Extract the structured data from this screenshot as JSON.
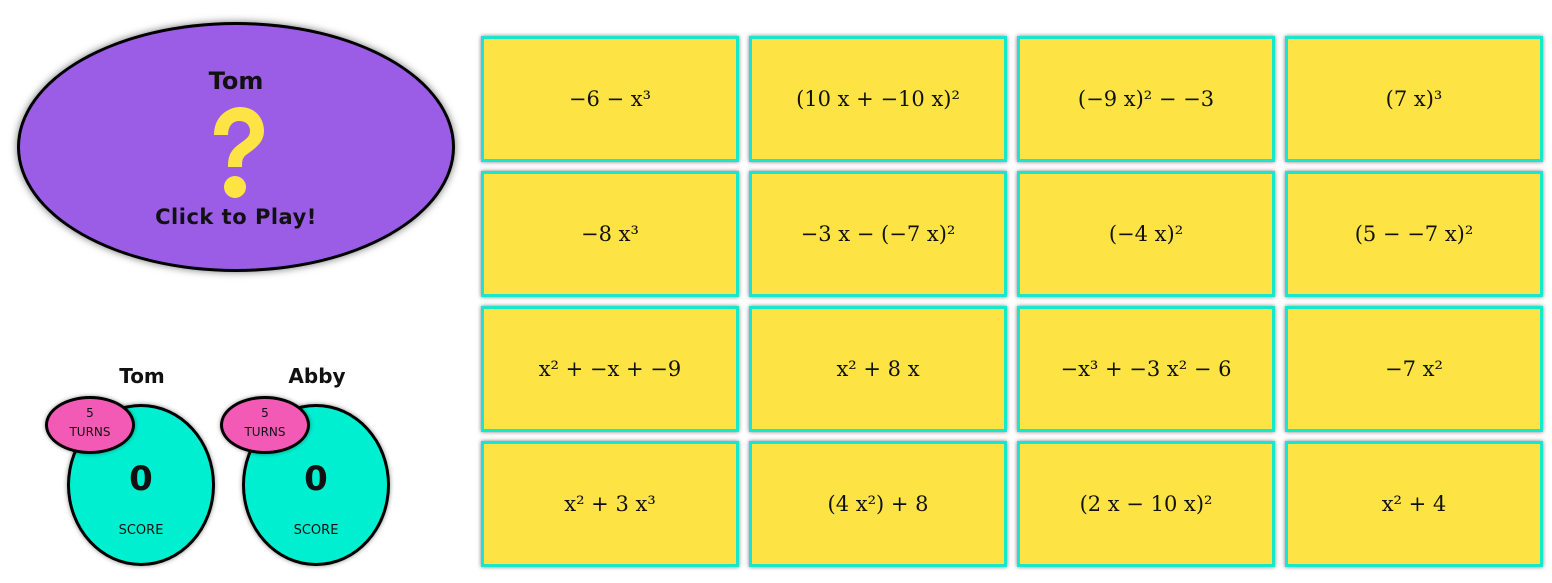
{
  "play_button": {
    "player_name": "Tom",
    "icon": "question-mark-icon",
    "label": "Click to Play!"
  },
  "players": [
    {
      "name": "Tom",
      "turns": "5",
      "turns_label": "TURNS",
      "score": "0",
      "score_label": "SCORE"
    },
    {
      "name": "Abby",
      "turns": "5",
      "turns_label": "TURNS",
      "score": "0",
      "score_label": "SCORE"
    }
  ],
  "cards": [
    "−6 − x³",
    "(10 x + −10 x)²",
    "(−9 x)² − −3",
    "(7 x)³",
    "−8 x³",
    "−3 x − (−7 x)²",
    "(−4 x)²",
    "(5 − −7 x)²",
    "x² + −x + −9",
    "x² + 8 x",
    "−x³ + −3 x² − 6",
    "−7 x²",
    "x² + 3 x³",
    "(4 x²) + 8",
    "(2 x − 10 x)²",
    "x² + 4"
  ],
  "colors": {
    "play_oval": "#9b5de5",
    "question_mark": "#fde444",
    "score_blob": "#00efd1",
    "turns_blob": "#f25ab5",
    "card_fill": "#fde444",
    "card_border": "#19e6cf"
  }
}
